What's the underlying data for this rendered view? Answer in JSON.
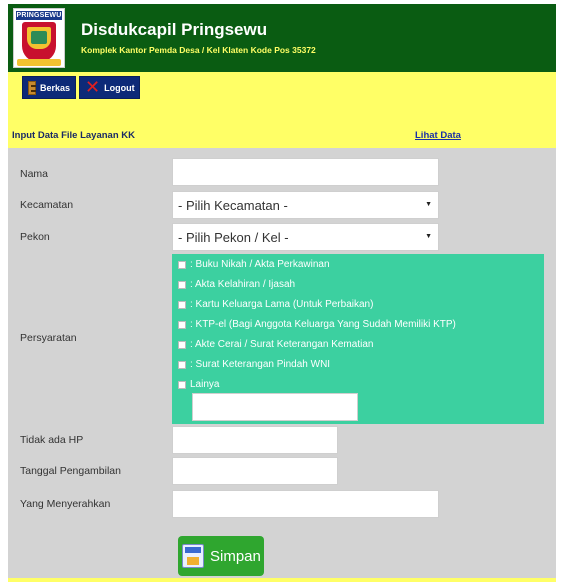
{
  "header": {
    "logo_text": "PRINGSEWU",
    "title": "Disdukcapil Pringsewu",
    "subtitle": "Komplek Kantor Pemda Desa / Kel Klaten Kode Pos 35372",
    "bg_color": "#0a5c12"
  },
  "nav": {
    "berkas_label": "Berkas",
    "logout_label": "Logout"
  },
  "section": {
    "title": "Input Data File Layanan KK",
    "view_link": "Lihat Data"
  },
  "form": {
    "nama_label": "Nama",
    "nama_value": "",
    "kecamatan_label": "Kecamatan",
    "kecamatan_selected": "- Pilih Kecamatan -",
    "pekon_label": "Pekon",
    "pekon_selected": "- Pilih Pekon / Kel -",
    "persyaratan_label": "Persyaratan",
    "persyaratan_items": [
      ": Buku Nikah / Akta Perkawinan",
      ": Akta Kelahiran / Ijasah",
      ": Kartu Keluarga Lama (Untuk Perbaikan)",
      ": KTP-el (Bagi Anggota Keluarga Yang Sudah Memiliki KTP)",
      ": Akte Cerai / Surat Keterangan Kematian",
      ": Surat Keterangan Pindah WNI",
      "Lainya"
    ],
    "lainya_value": "",
    "hp_label": "Tidak ada HP",
    "tanggal_label": "Tanggal Pengambilan",
    "menyerahkan_label": "Yang Menyerahkan",
    "save_label": "Simpan"
  },
  "colors": {
    "yellow_bar": "#ffff66",
    "form_bg": "#d3d3d3",
    "requirements_bg": "#3cd0a0",
    "save_button": "#2fa62f"
  }
}
